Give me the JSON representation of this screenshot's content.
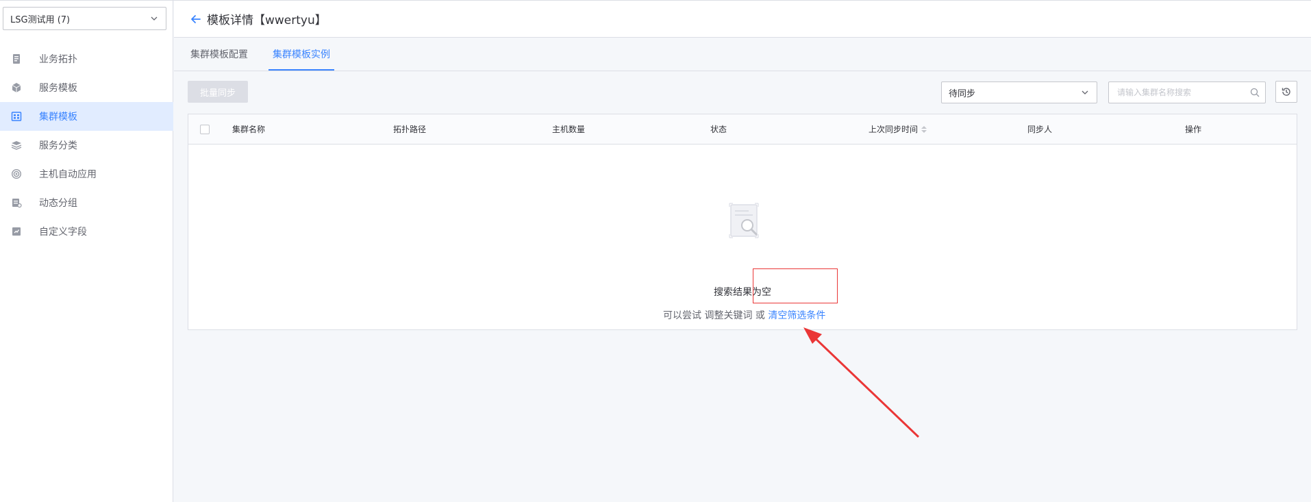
{
  "business_select": {
    "value": "LSG测试用 (7)"
  },
  "sidebar": {
    "items": [
      {
        "label": "业务拓扑",
        "icon": "topology-icon"
      },
      {
        "label": "服务模板",
        "icon": "cube-icon"
      },
      {
        "label": "集群模板",
        "icon": "cluster-template-icon",
        "active": true
      },
      {
        "label": "服务分类",
        "icon": "layers-icon"
      },
      {
        "label": "主机自动应用",
        "icon": "auto-apply-icon"
      },
      {
        "label": "动态分组",
        "icon": "dynamic-group-icon"
      },
      {
        "label": "自定义字段",
        "icon": "custom-field-icon"
      }
    ]
  },
  "header": {
    "title": "模板详情【wwertyu】"
  },
  "tabs": [
    {
      "label": "集群模板配置"
    },
    {
      "label": "集群模板实例",
      "active": true
    }
  ],
  "toolbar": {
    "batch_sync_label": "批量同步",
    "status_select_value": "待同步",
    "search_placeholder": "请输入集群名称搜索"
  },
  "table": {
    "columns": [
      "集群名称",
      "拓扑路径",
      "主机数量",
      "状态",
      "上次同步时间",
      "同步人",
      "操作"
    ]
  },
  "empty": {
    "title": "搜索结果为空",
    "tip_prefix": "可以尝试 调整关键词 或 ",
    "clear_link": "清空筛选条件"
  },
  "colors": {
    "accent": "#3a84ff",
    "annotation": "#ea3636",
    "active_bg": "#e1ecff"
  }
}
